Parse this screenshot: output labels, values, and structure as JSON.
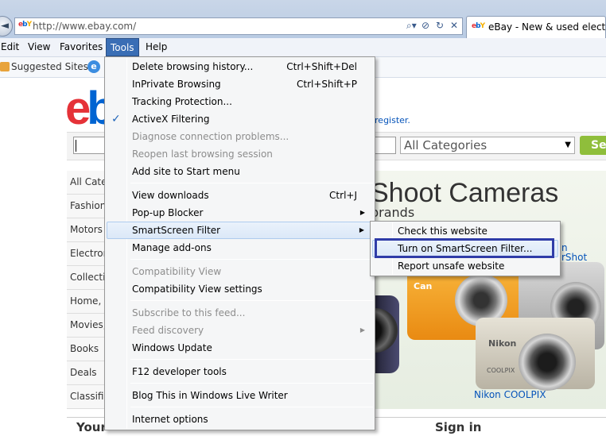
{
  "browser": {
    "address": {
      "favicon_text": "ebY",
      "url": "http://www.ebay.com/",
      "icons": [
        "search-dropdown-icon",
        "compat-view-icon",
        "refresh-icon",
        "stop-icon"
      ]
    },
    "tab": {
      "favicon_text": "ebY",
      "title": "eBay - New & used electro..."
    },
    "menubar": {
      "items": [
        "Edit",
        "View",
        "Favorites",
        "Tools",
        "Help"
      ],
      "active": "Tools"
    },
    "favorites_bar": {
      "suggested_sites": "Suggested Sites ▾"
    }
  },
  "page": {
    "logo": {
      "e": "e",
      "b": "b"
    },
    "register_text": "r register.",
    "category_select": "All Categories",
    "category_arrow": "▼",
    "go_label": "Se",
    "left_nav": [
      "All Cate",
      "Fashion",
      "Motors",
      "Electron",
      "Collectil",
      "Home, G",
      "Movies,",
      "Books",
      "Deals",
      "Classifi"
    ],
    "banner": {
      "title": "Shoot Cameras",
      "subtitle": "brands",
      "orange_brand": "Can",
      "silver_brand": "Nikon",
      "silver_model": "COOLPIX",
      "caption_nikon": "Nikon COOLPIX",
      "caption_right_1": "n",
      "caption_right_2": "rShot"
    },
    "bottom": {
      "text1": "Your",
      "text2": "",
      "text3": "Sign in"
    }
  },
  "tools_menu": {
    "items": [
      {
        "label": "Delete browsing history...",
        "shortcut": "Ctrl+Shift+Del"
      },
      {
        "label": "InPrivate Browsing",
        "shortcut": "Ctrl+Shift+P"
      },
      {
        "label": "Tracking Protection..."
      },
      {
        "label": "ActiveX Filtering",
        "checked": true
      },
      {
        "label": "Diagnose connection problems...",
        "disabled": true
      },
      {
        "label": "Reopen last browsing session",
        "disabled": true
      },
      {
        "label": "Add site to Start menu"
      },
      {
        "label": "View downloads",
        "shortcut": "Ctrl+J"
      },
      {
        "label": "Pop-up Blocker",
        "submenu": true
      },
      {
        "label": "SmartScreen Filter",
        "submenu": true,
        "hover": true
      },
      {
        "label": "Manage add-ons"
      },
      {
        "label": "Compatibility View",
        "disabled": true
      },
      {
        "label": "Compatibility View settings"
      },
      {
        "label": "Subscribe to this feed...",
        "disabled": true
      },
      {
        "label": "Feed discovery",
        "disabled": true,
        "submenu": true
      },
      {
        "label": "Windows Update"
      },
      {
        "label": "F12 developer tools"
      },
      {
        "label": "Blog This in Windows Live Writer"
      },
      {
        "label": "Internet options"
      }
    ],
    "check_glyph": "✓",
    "arrow_glyph": "▶"
  },
  "smartscreen_submenu": {
    "items": [
      {
        "label": "Check this website"
      },
      {
        "label": "Turn on SmartScreen Filter...",
        "hover": true,
        "highlighted": true
      },
      {
        "label": "Report unsafe website"
      }
    ],
    "highlight_color": "#2f3ca8"
  },
  "colors": {
    "menu_active": "#3a6eb5",
    "ebay_red": "#e53238",
    "ebay_blue": "#0064d2",
    "link_blue": "#0654ba",
    "go_green": "#8fbe3b"
  }
}
